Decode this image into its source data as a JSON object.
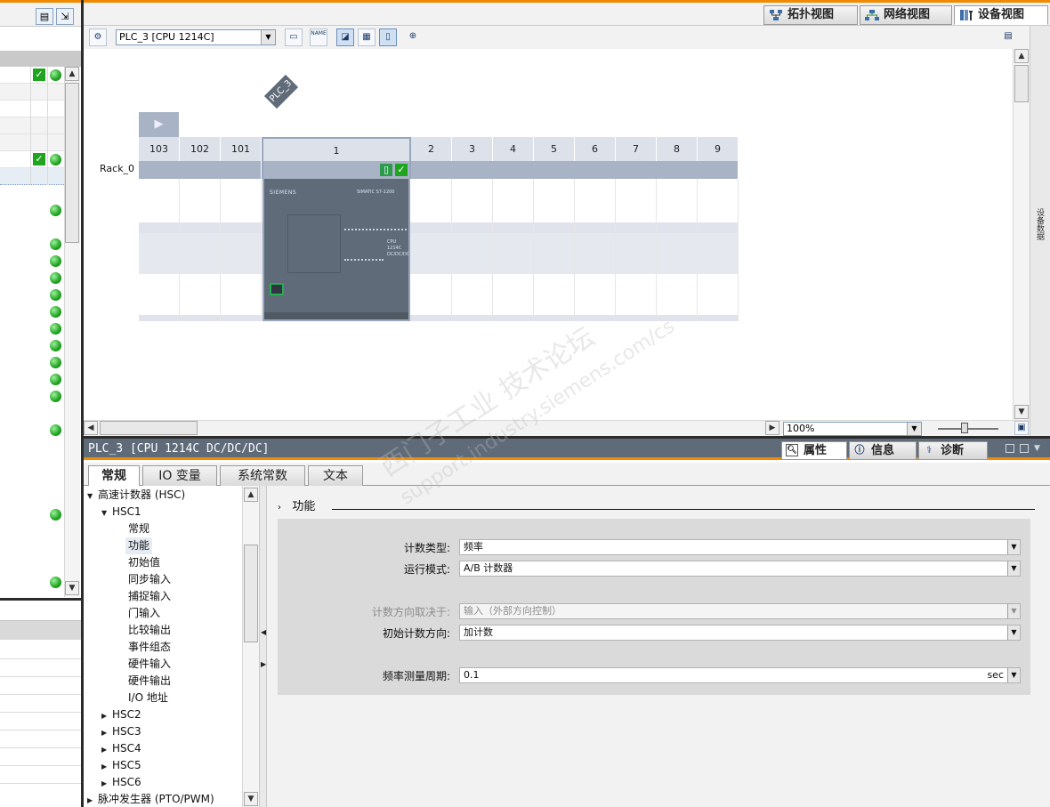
{
  "view_tabs": {
    "topology": "拓扑视图",
    "network": "网络视图",
    "device": "设备视图"
  },
  "toolbar": {
    "device_select": "PLC_3 [CPU 1214C]",
    "name_btn": "NAME"
  },
  "canvas": {
    "plc_label": "PLC_3",
    "rack_label": "Rack_0",
    "slots": [
      "103",
      "102",
      "101",
      "1",
      "2",
      "3",
      "4",
      "5",
      "6",
      "7",
      "8",
      "9"
    ],
    "cpu_brand": "SIEMENS",
    "cpu_family": "SIMATIC S7-1200",
    "cpu_model": "CPU 1214C DC/DC/DC"
  },
  "zoom": {
    "value": "100%"
  },
  "side_strip": {
    "label": "设备数据"
  },
  "properties": {
    "title": "PLC_3 [CPU 1214C DC/DC/DC]",
    "tabs": {
      "properties": "属性",
      "info": "信息",
      "diagnostics": "诊断"
    },
    "sub_tabs": [
      "常规",
      "IO 变量",
      "系统常数",
      "文本"
    ]
  },
  "tree": {
    "hsc_group": "高速计数器 (HSC)",
    "hsc1": "HSC1",
    "hsc1_children": [
      "常规",
      "功能",
      "初始值",
      "同步输入",
      "捕捉输入",
      "门输入",
      "比较输出",
      "事件组态",
      "硬件输入",
      "硬件输出",
      "I/O 地址"
    ],
    "hsc_others": [
      "HSC2",
      "HSC3",
      "HSC4",
      "HSC5",
      "HSC6"
    ],
    "pulse_group": "脉冲发生器 (PTO/PWM)"
  },
  "section": {
    "title": "功能"
  },
  "form": {
    "count_type_label": "计数类型:",
    "count_type_value": "频率",
    "op_mode_label": "运行模式:",
    "op_mode_value": "A/B 计数器",
    "dir_source_label": "计数方向取决于:",
    "dir_source_value": "输入（外部方向控制）",
    "init_dir_label": "初始计数方向:",
    "init_dir_value": "加计数",
    "freq_period_label": "频率测量周期:",
    "freq_period_value": "0.1",
    "freq_period_unit": "sec"
  },
  "watermark": {
    "line1": "西门子工业  技术论坛",
    "line2": "support.industry.siemens.com/cs"
  },
  "colors": {
    "accent": "#f08a00",
    "header": "#5f6b78",
    "status_ok": "#1fa31f"
  }
}
